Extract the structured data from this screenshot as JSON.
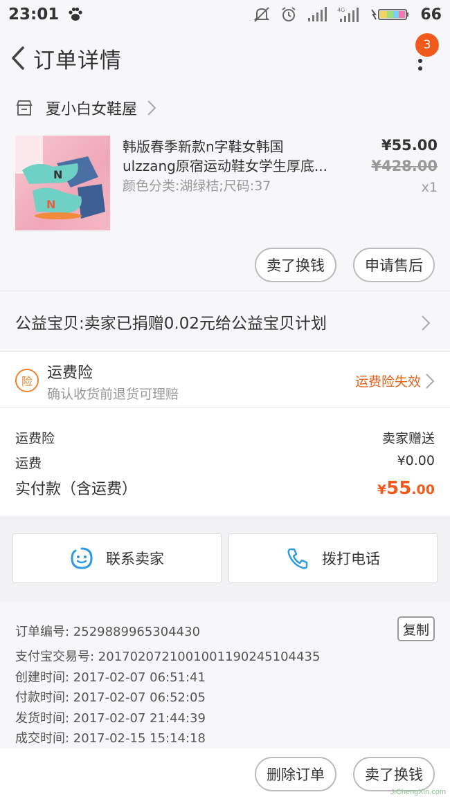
{
  "status_bar": {
    "time": "23:01",
    "battery_percent": "66",
    "icons": [
      "paw-icon",
      "mute-icon",
      "alarm-icon",
      "signal-icon",
      "4g-signal-icon",
      "battery-icon"
    ]
  },
  "nav": {
    "title": "订单详情",
    "badge_count": "3"
  },
  "shop": {
    "name": "夏小白女鞋屋"
  },
  "product": {
    "name_line1": "韩版春季新款n字鞋女韩国",
    "name_line2": "ulzzang原宿运动鞋女学生厚底...",
    "sku": "颜色分类:湖绿桔;尺码:37",
    "price": "¥55.00",
    "original_price": "¥428.00",
    "quantity": "x1"
  },
  "product_actions": {
    "resell": "卖了换钱",
    "after_sales": "申请售后"
  },
  "charity": {
    "text": "公益宝贝:卖家已捐赠0.02元给公益宝贝计划"
  },
  "insurance": {
    "title": "运费险",
    "subtitle": "确认收货前退货可理赔",
    "status": "运费险失效"
  },
  "fees": {
    "insurance_label": "运费险",
    "insurance_value": "卖家赠送",
    "shipping_label": "运费",
    "shipping_value": "¥0.00",
    "total_label": "实付款（含运费）",
    "total_currency": "¥",
    "total_int": "55",
    "total_dec": ".00"
  },
  "contact": {
    "seller": "联系卖家",
    "phone": "拨打电话"
  },
  "order_info": {
    "order_no": "订单编号: 2529889965304430",
    "alipay_no": "支付宝交易号: 2017020721001001190245104435",
    "created": "创建时间: 2017-02-07 06:51:41",
    "paid": "付款时间: 2017-02-07 06:52:05",
    "shipped": "发货时间: 2017-02-07 21:44:39",
    "completed": "成交时间: 2017-02-15 15:14:18",
    "copy_label": "复制"
  },
  "bottom_actions": {
    "delete": "删除订单",
    "resell": "卖了换钱"
  },
  "watermark": "JiChengXin.com",
  "colors": {
    "accent": "#f25a1d",
    "insurance_orange": "#e4631d",
    "contact_blue": "#2e9be0"
  }
}
